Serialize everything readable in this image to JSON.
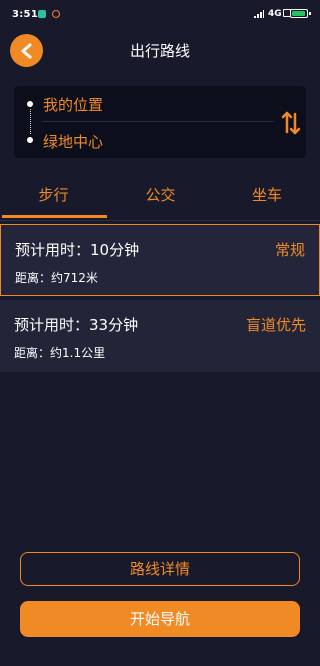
{
  "status_bar": {
    "time": "3:51",
    "network": "4G"
  },
  "header": {
    "title": "出行路线",
    "back_icon": "chevron-left-icon"
  },
  "route": {
    "from": "我的位置",
    "to": "绿地中心",
    "swap_icon": "swap-vertical-icon"
  },
  "tabs": [
    {
      "label": "步行",
      "active": true
    },
    {
      "label": "公交",
      "active": false
    },
    {
      "label": "坐车",
      "active": false
    }
  ],
  "options": [
    {
      "time": "预计用时：10分钟",
      "distance": "距离：约712米",
      "tag": "常规",
      "selected": true
    },
    {
      "time": "预计用时：33分钟",
      "distance": "距离：约1.1公里",
      "tag": "盲道优先",
      "selected": false
    }
  ],
  "buttons": {
    "detail": "路线详情",
    "start": "开始导航"
  },
  "colors": {
    "accent": "#f08a24",
    "background": "#181a2c",
    "card": "#222438",
    "route_card": "#0c0e1b"
  }
}
